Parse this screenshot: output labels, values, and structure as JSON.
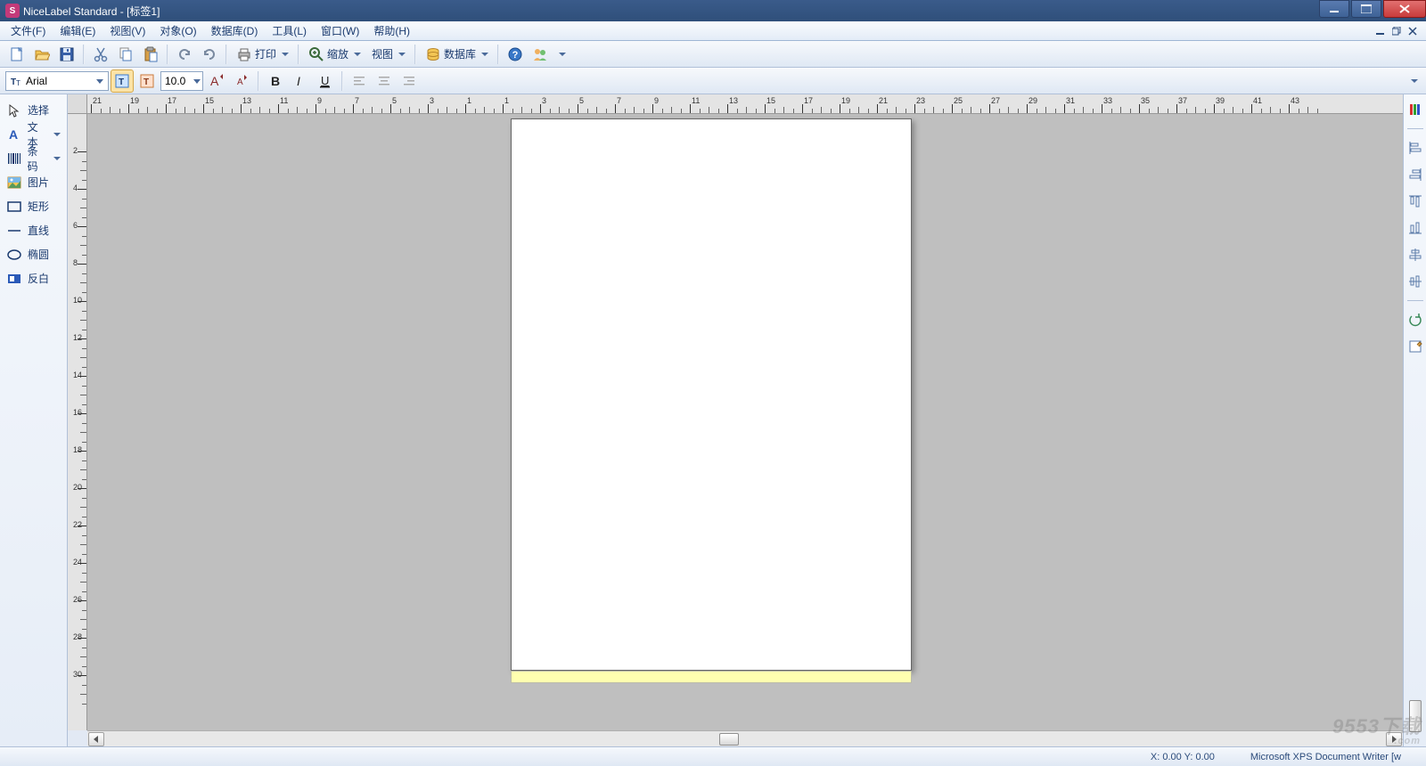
{
  "title": "NiceLabel Standard - [标签1]",
  "menu": {
    "file": "文件(F)",
    "edit": "编辑(E)",
    "view": "视图(V)",
    "object": "对象(O)",
    "database": "数据库(D)",
    "tools": "工具(L)",
    "window": "窗口(W)",
    "help": "帮助(H)"
  },
  "toolbar1": {
    "print": "打印",
    "zoom": "缩放",
    "viewmenu": "视图",
    "database": "数据库"
  },
  "font": {
    "name": "Arial",
    "size": "10.0"
  },
  "tools": {
    "select": "选择",
    "text": "文本",
    "barcode": "条码",
    "image": "图片",
    "rect": "矩形",
    "line": "直线",
    "ellipse": "椭圆",
    "inverse": "反白"
  },
  "status": {
    "coord": "X:    0.00 Y:    0.00",
    "printer": "Microsoft XPS Document Writer [w"
  },
  "h_ruler_ticks": [
    -21,
    -19,
    -17,
    -15,
    -13,
    -11,
    -9,
    -7,
    -5,
    -3,
    -1,
    1,
    3,
    5,
    7,
    9,
    11,
    13,
    15,
    17,
    19,
    21,
    23,
    25,
    27,
    29,
    31,
    33,
    35,
    37,
    39,
    41,
    43
  ],
  "v_ruler_ticks": [
    2,
    4,
    6,
    8,
    10,
    12,
    14,
    16,
    18,
    20,
    22,
    24,
    26,
    28,
    30
  ],
  "watermark": "9553下载",
  "watermark_sub": ".com"
}
